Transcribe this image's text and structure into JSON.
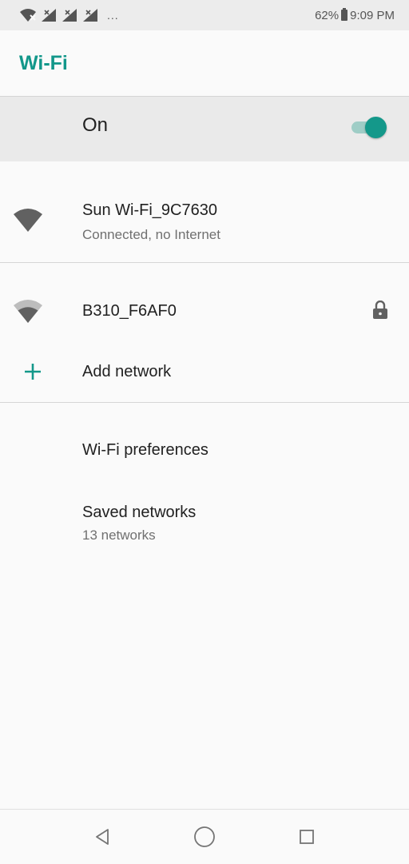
{
  "status_bar": {
    "battery": "62%",
    "time": "9:09 PM",
    "more": "...",
    "icons": [
      "wifi-x-icon",
      "signal-x-icon",
      "signal-x-icon",
      "signal-x-icon",
      "battery-icon"
    ]
  },
  "app_bar": {
    "title": "Wi-Fi"
  },
  "master_switch": {
    "label": "On",
    "state": "on",
    "accent": "#14988a"
  },
  "connected_network": {
    "ssid": "Sun Wi-Fi_9C7630",
    "status": "Connected, no Internet",
    "icon": "wifi-signal-full-icon"
  },
  "available_networks": [
    {
      "ssid": "B310_F6AF0",
      "icon": "wifi-signal-medium-icon",
      "secured": true
    }
  ],
  "add_network": {
    "label": "Add network",
    "icon": "plus-icon"
  },
  "preferences": {
    "label": "Wi-Fi preferences"
  },
  "saved_networks": {
    "label": "Saved networks",
    "summary": "13 networks"
  },
  "nav_bar": {
    "buttons": [
      "back-icon",
      "home-icon",
      "recents-icon"
    ]
  }
}
